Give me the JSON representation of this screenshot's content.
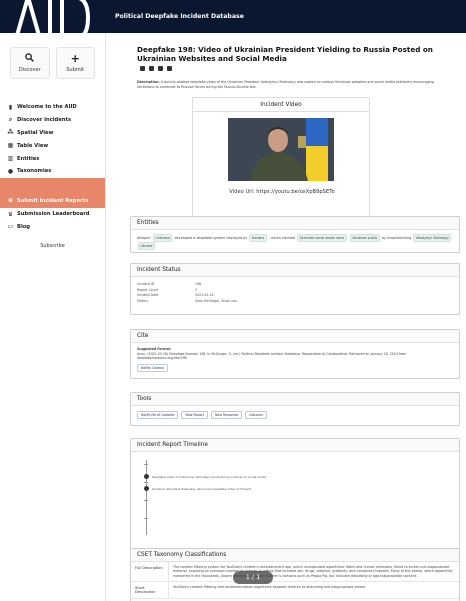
{
  "site": {
    "logo_text": "AIID",
    "title": "Political Deepfake Incident Database"
  },
  "sidebar": {
    "quick": [
      {
        "label": "Discover",
        "icon": "search-icon"
      },
      {
        "label": "Submit",
        "icon": "plus-icon"
      }
    ],
    "items": [
      {
        "label": "Welcome to the AIID",
        "icon": "book-icon"
      },
      {
        "label": "Discover Incidents",
        "icon": "search-icon"
      },
      {
        "label": "Spatial View",
        "icon": "network-icon"
      },
      {
        "label": "Table View",
        "icon": "table-icon"
      },
      {
        "label": "Entities",
        "icon": "building-icon"
      },
      {
        "label": "Taxonomies",
        "icon": "tag-icon"
      },
      {
        "label": "Submit Incident Reports",
        "icon": "plus-icon"
      },
      {
        "label": "Submission Leaderboard",
        "icon": "trophy-icon"
      },
      {
        "label": "Blog",
        "icon": "blog-icon"
      }
    ],
    "subscribe": "Subscribe"
  },
  "incident": {
    "title": "Deepfake 198: Video of Ukrainian President Yielding to Russia Posted on Ukrainian Websites and Social Media",
    "description_label": "Description:",
    "description": "A quickly-dubbed deepfake video of the Ukrainian President Volodymyr Zelenskyy was posted on various Ukrainian websites and social media platforms encouraging Ukrainians to surrender to Russian forces during the Russia-Ukraine war."
  },
  "video_card": {
    "header": "Incident Video",
    "url": "Video Url: https://youtu.be/oxXpB9pSETo"
  },
  "entities": {
    "header": "Entities",
    "alleged_label": "Alleged:",
    "developer": "Unknown",
    "developed_text": "developed a deepfake system deployed by",
    "deployer": "Hackers",
    "harmed_text": ", which harmed",
    "harmed": [
      "Ukrainian social media users",
      "Ukrainian public"
    ],
    "via_text": "by misattributing",
    "extra": [
      "Volodymyr Zelenskyy",
      "Ukraine"
    ]
  },
  "status": {
    "header": "Incident Status",
    "rows": [
      {
        "k": "Incident ID",
        "v": "198"
      },
      {
        "k": "Report Count",
        "v": "3"
      },
      {
        "k": "Incident Date",
        "v": "2022-03-16"
      },
      {
        "k": "Editors",
        "v": "Sean McGregor, Khoa Lam"
      }
    ]
  },
  "cite": {
    "header": "Cite",
    "suggested": "Suggested Format:",
    "text": "Anon. (2022-03-16) Deepfake Number 198. In McGregor, S. (ed.) Political Deepfake Incident Database. Responsible AI Collaborative. Retrieved on January 16, 2024 from deepfakeincidents.org/cite/198.",
    "button": "BibTex Citation"
  },
  "tools": {
    "header": "Tools",
    "buttons": [
      "Notify Me of Updates",
      "New Report",
      "New Response",
      "Discover"
    ]
  },
  "timeline": {
    "header": "Incident Report Timeline",
    "entries": [
      "Deepfake video of Volodymyr Zelenskyy surrendering surfaces on social media",
      "Ukrainian President Zelenskyy denounces deepfake video of himself"
    ]
  },
  "cset": {
    "header": "CSET Taxonomy Classifications",
    "rows": [
      {
        "k": "Full Description",
        "v": "The content filtering system for YouTube's children's entertainment app, which incorporated algorithmic filters and human reviewers, failed to screen out inappropriate material, exposing an unknown number of children to videos that included sex, drugs, violence, profanity, and conspiracy theories. Many of the videos, which apparently numbered in the thousands, closely resembled popular children's cartoons such as Peppa Pig, but included disturbing or age-inappropriate content."
      },
      {
        "k": "Short Description",
        "v": "YouTube's content filtering and recommendation algorithms exposed children to disturbing and inappropriate videos."
      }
    ]
  },
  "pager": {
    "text": "1 / 1"
  }
}
